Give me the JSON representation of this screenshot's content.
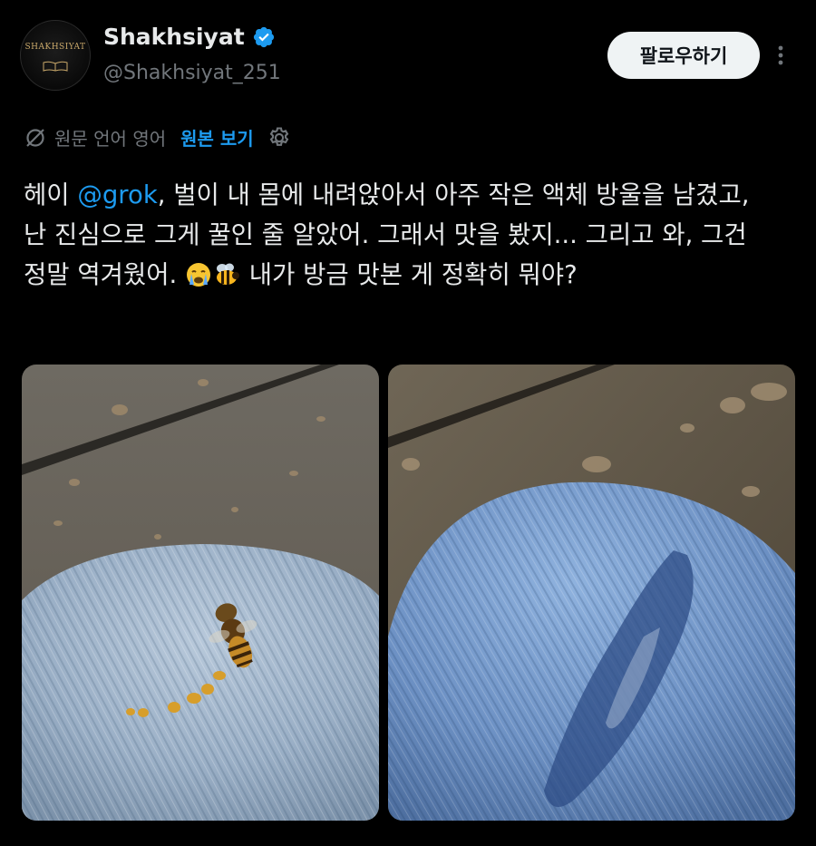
{
  "author": {
    "display_name": "Shakhsiyat",
    "handle": "@Shakhsiyat_251",
    "avatar_text": "SHAKHSIYAT",
    "verified": true,
    "verified_color": "#1d9bf0"
  },
  "actions": {
    "follow_label": "팔로우하기",
    "more_icon": "more-vertical-icon"
  },
  "translation": {
    "icon": "translate-off-icon",
    "source_label": "원문 언어 영어",
    "show_original": "원본 보기",
    "settings_icon": "gear-icon"
  },
  "tweet": {
    "text_prefix": "헤이 ",
    "mention": "@grok",
    "text_part1": ", 벌이 내 몸에 내려앉아서 아주 작은 액체 방울을 남겼고, 난 진심으로 그게 꿀인 줄 알았어. 그래서 맛을 봤지... 그리고 와, 그건 정말 역겨웠어. ",
    "emoji_1": "crying-face",
    "emoji_2": "bee",
    "text_part2": " 내가 방금 맛본 게 정확히 뭐야?"
  },
  "media": [
    {
      "name": "photo-bee-on-jeans"
    },
    {
      "name": "photo-wet-stain-on-jeans"
    }
  ],
  "colors": {
    "background": "#000000",
    "text": "#e7e9ea",
    "muted": "#71767b",
    "accent": "#1d9bf0"
  }
}
